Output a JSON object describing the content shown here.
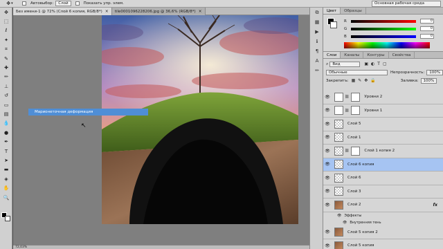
{
  "options_bar": {
    "autoselect_label": "Автовыбор:",
    "autoselect_value": "Слой",
    "show_controls_label": "Показать упр. элем.",
    "workspace": "Основная рабочая среда"
  },
  "doc_tabs": [
    {
      "label": "Без имени-1 @ 72% (Слой 6 копия, RGB/8*)"
    },
    {
      "label": "tile0001096228206.jpg @ 36,6% (RGB/8*)"
    }
  ],
  "canvas": {
    "context_menu_item": "Марионеточная деформация"
  },
  "status": {
    "zoom": "72,03%"
  },
  "color_panel": {
    "tabs": [
      "Цвет",
      "Образцы"
    ],
    "channels": [
      {
        "name": "R",
        "value": "0",
        "from": "#000000",
        "to": "#ff0000"
      },
      {
        "name": "G",
        "value": "0",
        "from": "#000000",
        "to": "#00ff00"
      },
      {
        "name": "B",
        "value": "0",
        "from": "#000000",
        "to": "#0000ff"
      }
    ]
  },
  "layers_panel": {
    "tabs": [
      "Слои",
      "Каналы",
      "Контуры",
      "Свойства"
    ],
    "kind": "Вид",
    "blend_mode": "Обычные",
    "opacity_label": "Непрозрачность:",
    "opacity": "100%",
    "lock_label": "Закрепить:",
    "fill_label": "Заливка:",
    "fill": "100%",
    "layers": [
      {
        "name": "Уровни 2",
        "thumb": "t-levels",
        "mask": true,
        "selected": false,
        "fx": ""
      },
      {
        "name": "Уровни 1",
        "thumb": "t-levels",
        "mask": true,
        "selected": false,
        "fx": ""
      },
      {
        "name": "Слой 5",
        "thumb": "checker",
        "mask": false,
        "selected": false,
        "fx": ""
      },
      {
        "name": "Слой 1",
        "thumb": "checker",
        "mask": false,
        "selected": false,
        "fx": ""
      },
      {
        "name": "Слой 1 копия 2",
        "thumb": "checker",
        "mask": true,
        "selected": false,
        "fx": ""
      },
      {
        "name": "Слой 6 копия",
        "thumb": "checker",
        "mask": false,
        "selected": true,
        "fx": ""
      },
      {
        "name": "Слой 6",
        "thumb": "checker",
        "mask": false,
        "selected": false,
        "fx": ""
      },
      {
        "name": "Слой 3",
        "thumb": "checker",
        "mask": false,
        "selected": false,
        "fx": ""
      },
      {
        "name": "Слой 2",
        "thumb": "t-dirt",
        "mask": false,
        "selected": false,
        "fx": "fx"
      },
      {
        "name": "Слой 5 копия 2",
        "thumb": "t-dirt",
        "mask": false,
        "selected": false,
        "fx": ""
      },
      {
        "name": "Слой 5 копия",
        "thumb": "t-dirt",
        "mask": false,
        "selected": false,
        "fx": ""
      }
    ],
    "effects_label": "Эффекты",
    "effect_item": "Внутренняя тень"
  }
}
